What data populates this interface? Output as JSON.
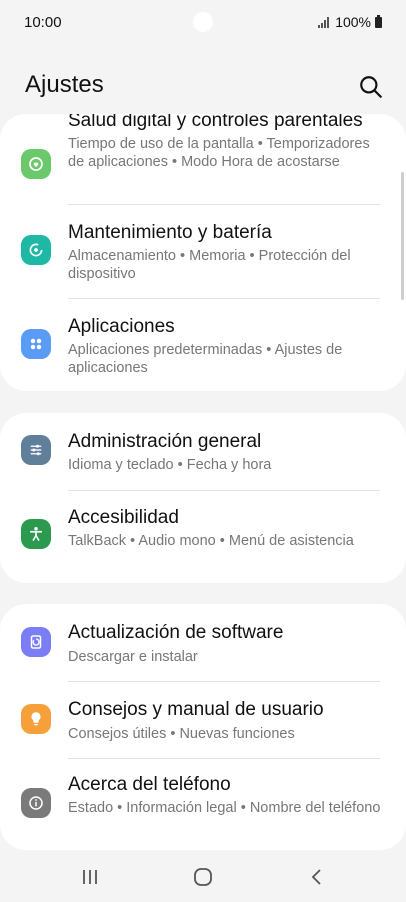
{
  "status": {
    "time": "10:00",
    "battery": "100%"
  },
  "header": {
    "title": "Ajustes"
  },
  "groups": [
    [
      {
        "title": "Salud digital y controles parentales",
        "subtitle": "Tiempo de uso de la pantalla  •  Temporizadores de aplicaciones  •  Modo Hora de acostarse",
        "icon": "wellbeing-icon",
        "color": "#6cc96b"
      },
      {
        "title": "Mantenimiento y batería",
        "subtitle": "Almacenamiento  •  Memoria  •  Protección del dispositivo",
        "icon": "device-care-icon",
        "color": "#1fb7a5"
      },
      {
        "title": "Aplicaciones",
        "subtitle": "Aplicaciones predeterminadas  •  Ajustes de aplicaciones",
        "icon": "apps-icon",
        "color": "#5a9bf6"
      }
    ],
    [
      {
        "title": "Administración general",
        "subtitle": "Idioma y teclado  •  Fecha y hora",
        "icon": "general-management-icon",
        "color": "#5f7f9a"
      },
      {
        "title": "Accesibilidad",
        "subtitle": "TalkBack  •  Audio mono  •  Menú de asistencia",
        "icon": "accessibility-icon",
        "color": "#2c9a4e"
      }
    ],
    [
      {
        "title": "Actualización de software",
        "subtitle": "Descargar e instalar",
        "icon": "software-update-icon",
        "color": "#7a7df3"
      },
      {
        "title": "Consejos y manual de usuario",
        "subtitle": "Consejos útiles  •  Nuevas funciones",
        "icon": "tips-icon",
        "color": "#f5a03a"
      },
      {
        "title": "Acerca del teléfono",
        "subtitle": "Estado  •  Información legal  •  Nombre del teléfono",
        "icon": "about-phone-icon",
        "color": "#7a7a7a"
      }
    ]
  ]
}
